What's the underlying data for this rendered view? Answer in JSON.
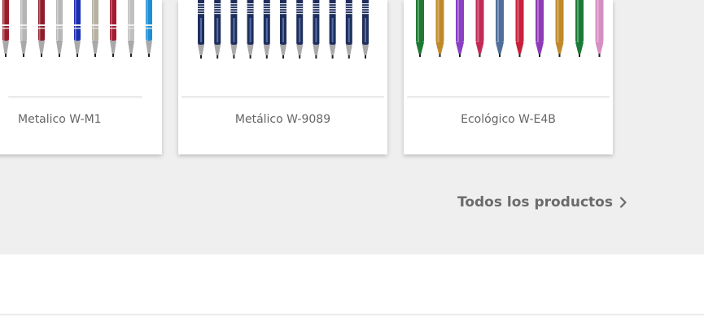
{
  "products": [
    {
      "name": "Metalico W-M1",
      "pen_style": "metallic-multicolor",
      "pen_colors": [
        "#c8c8c8",
        "#9a1b2a",
        "#b5b5b5",
        "#8e1c2b",
        "#b8b8b8",
        "#1c2fb0",
        "#b7b1a2",
        "#a31c2f",
        "#c0c0c0",
        "#1e8fd6",
        "#1d1d1d"
      ]
    },
    {
      "name": "Metálico W-9089",
      "pen_style": "navy-patterned",
      "pen_colors": [
        "#1f2e5c",
        "#1f2e5c",
        "#1f2e5c",
        "#1f2e5c",
        "#1f2e5c",
        "#1f2e5c",
        "#1f2e5c",
        "#1f2e5c",
        "#1f2e5c",
        "#1f2e5c",
        "#1f2e5c"
      ]
    },
    {
      "name": "Ecológico W-E4B",
      "pen_style": "eco-colored",
      "pen_colors": [
        "#1e7a33",
        "#c08a2a",
        "#8a3fc4",
        "#c32a55",
        "#4f6f9a",
        "#c81f3a",
        "#8f3ab8",
        "#c08a2a",
        "#1a7a35",
        "#d68fc4"
      ]
    }
  ],
  "all_products": {
    "label": "Todos los productos",
    "icon": "chevron-right-icon"
  },
  "colors": {
    "section_background": "#efefef",
    "card_background": "#ffffff",
    "text": "#666666",
    "link": "#6b6b6b"
  }
}
